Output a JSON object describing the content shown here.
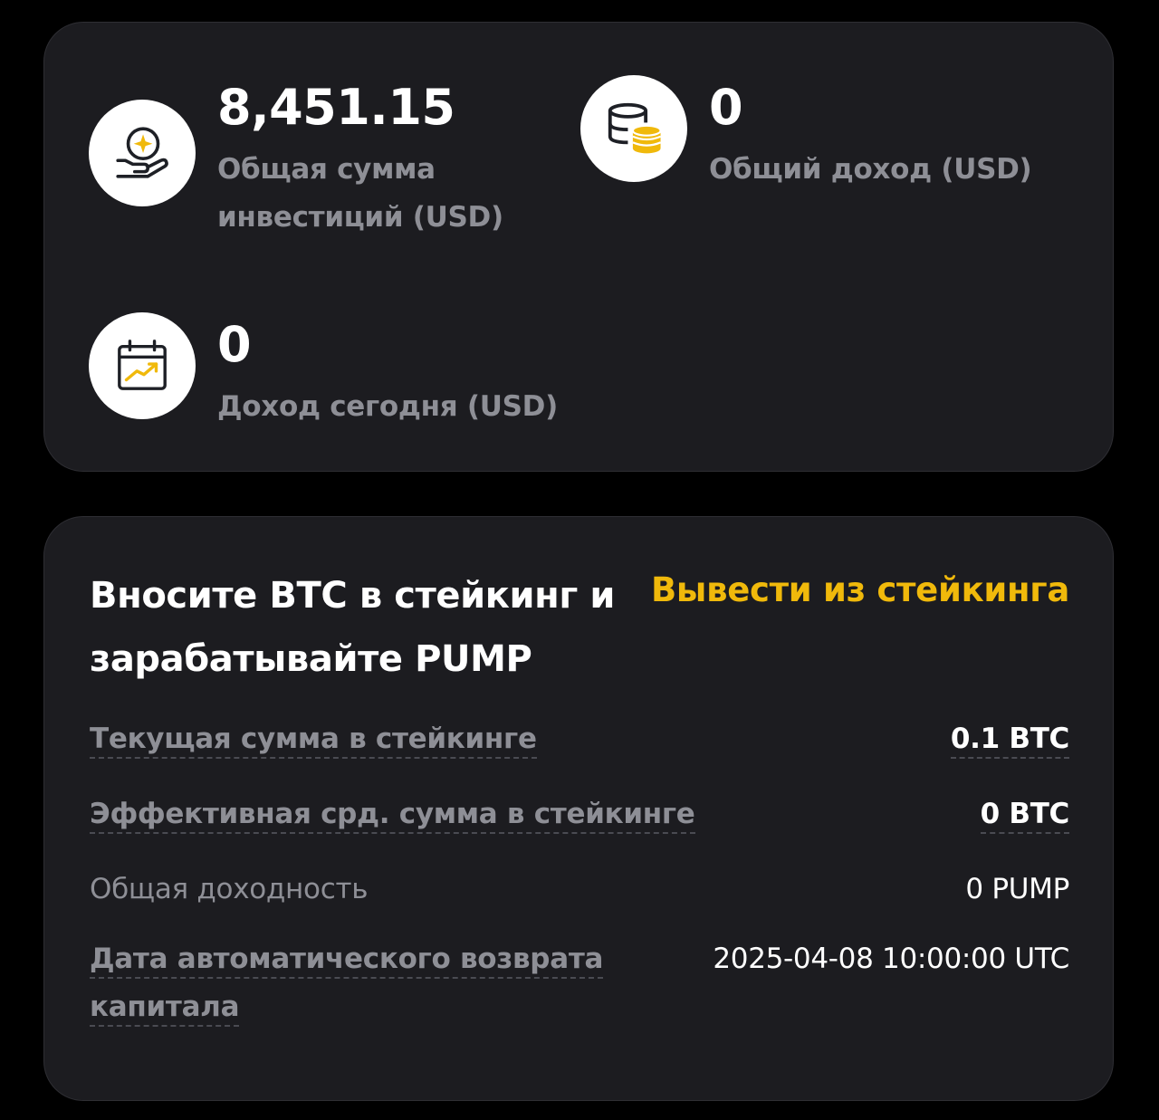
{
  "stats": {
    "total_invested": {
      "value": "8,451.15",
      "label_line1": "Общая сумма",
      "label_line2": "инвестиций (USD)",
      "icon": "hand-star-icon"
    },
    "total_income": {
      "value": "0",
      "label": "Общий доход (USD)",
      "icon": "coins-stack-icon"
    },
    "today_income": {
      "value": "0",
      "label": "Доход сегодня (USD)",
      "icon": "calendar-chart-icon"
    }
  },
  "staking": {
    "title_line1": "Вносите BTC в стейкинг и",
    "title_line2": "зарабатывайте PUMP",
    "withdraw_label": "Вывести из стейкинга",
    "rows": [
      {
        "label": "Текущая сумма в стейкинге",
        "value": "0.1 BTC"
      },
      {
        "label": "Эффективная срд. сумма в стейкинге",
        "value": "0 BTC"
      },
      {
        "label": "Общая доходность",
        "value": "0 PUMP"
      },
      {
        "label_line1": "Дата автоматического возврата",
        "label_line2": "капитала",
        "value": "2025-04-08 10:00:00 UTC"
      }
    ]
  },
  "colors": {
    "background": "#000000",
    "card": "#1c1c20",
    "accent": "#f0b90b",
    "muted_text": "#8e8f96",
    "primary_text": "#ffffff"
  }
}
